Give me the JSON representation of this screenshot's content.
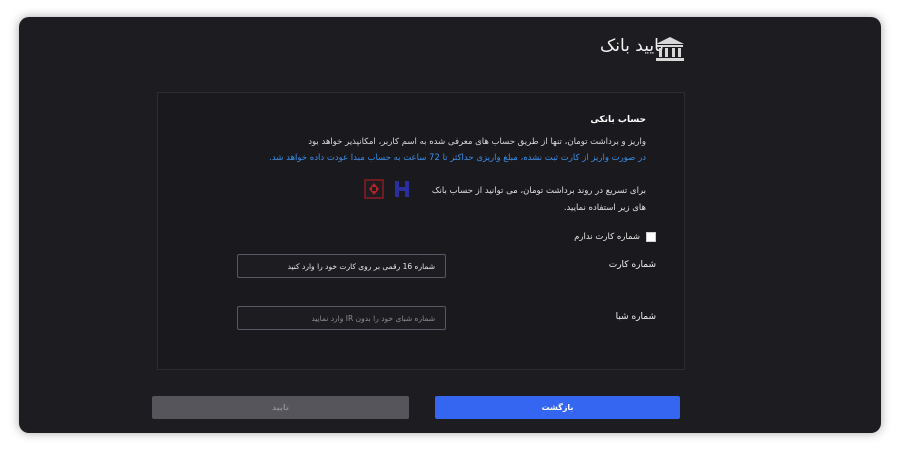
{
  "header": {
    "title": "تایید بانک",
    "icon": "bank-icon"
  },
  "section": {
    "title": "حساب بانکی",
    "info": "واریز و برداشت تومان، تنها از طریق حساب های معرفی شده به اسم کاربر، امکانپذیر خواهد بود",
    "warning": "در صورت واریز از کارت ثبت نشده، مبلغ واریزی حداکثر تا 72 ساعت به حساب مبدا عودت داده خواهد شد.",
    "warning_color": "#3d8fe8",
    "tip": "برای تسریع در روند برداشت تومان، می توانید از حساب بانک های زیر استفاده نمایید.",
    "bank_logos": [
      "saderat-logo-icon",
      "saman-logo-icon"
    ]
  },
  "form": {
    "no_card_label": "شماره کارت ندارم",
    "card_label": "شماره کارت",
    "card_value": "شماره 16 رقمی بر روی کارت خود را وارد کنید",
    "iban_label": "شماره شبا",
    "iban_placeholder": "شماره شبای خود را بدون IR وارد نمایید"
  },
  "buttons": {
    "confirm": "تایید",
    "back": "بازگشت",
    "accent": "#3566f2"
  }
}
